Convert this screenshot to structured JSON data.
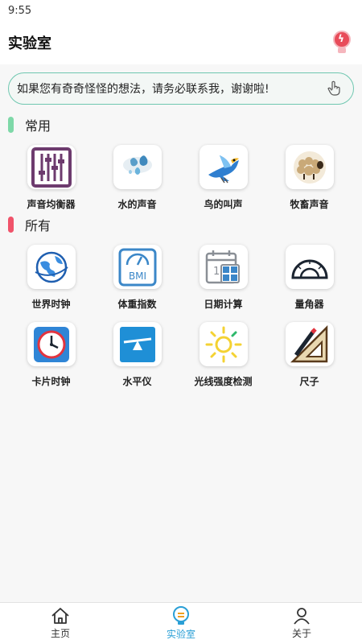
{
  "status_bar": {
    "time": "9:55"
  },
  "app_bar": {
    "title": "实验室",
    "action_icon": "lightbulb-icon"
  },
  "notice": {
    "text": "如果您有奇奇怪怪的想法，请务必联系我，谢谢啦!",
    "icon": "hand-pointer-icon"
  },
  "sections": {
    "common": {
      "title": "常用",
      "accent": "#7ed8a8",
      "items": [
        {
          "label": "声音均衡器",
          "icon": "equalizer-icon"
        },
        {
          "label": "水的声音",
          "icon": "water-drops-icon"
        },
        {
          "label": "鸟的叫声",
          "icon": "bird-icon"
        },
        {
          "label": "牧畜声音",
          "icon": "sheep-icon"
        }
      ]
    },
    "all": {
      "title": "所有",
      "accent": "#f0536a",
      "items": [
        {
          "label": "世界时钟",
          "icon": "globe-clock-icon"
        },
        {
          "label": "体重指数",
          "icon": "bmi-scale-icon"
        },
        {
          "label": "日期计算",
          "icon": "calendar-calculator-icon"
        },
        {
          "label": "量角器",
          "icon": "protractor-icon"
        },
        {
          "label": "卡片时钟",
          "icon": "clock-icon"
        },
        {
          "label": "水平仪",
          "icon": "level-icon"
        },
        {
          "label": "光线强度检测",
          "icon": "sun-icon"
        },
        {
          "label": "尺子",
          "icon": "ruler-icon"
        }
      ]
    }
  },
  "tabs": [
    {
      "label": "主页",
      "icon": "home-icon",
      "active": false
    },
    {
      "label": "实验室",
      "icon": "lab-bulb-icon",
      "active": true
    },
    {
      "label": "关于",
      "icon": "person-icon",
      "active": false
    }
  ],
  "colors": {
    "accent": "#2a9fd6",
    "notice_border": "#6fc7b0"
  }
}
